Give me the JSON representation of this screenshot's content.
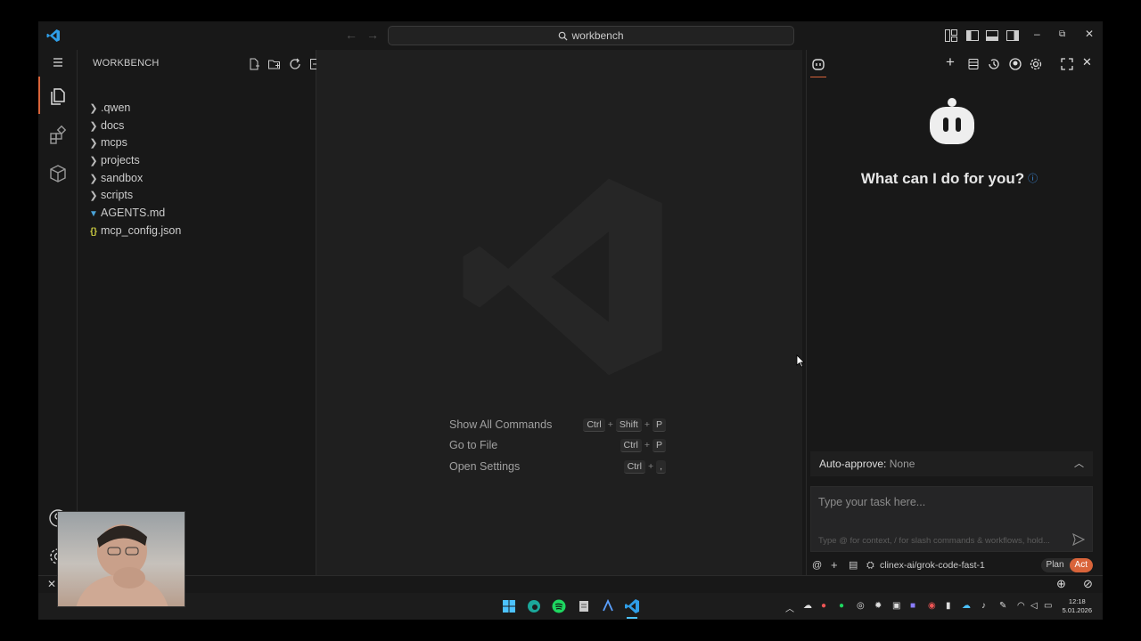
{
  "titlebar": {
    "search_text": "workbench",
    "icons": [
      "vscode-logo",
      "back-arrow",
      "forward-arrow",
      "search-icon",
      "layout-icon",
      "sidebar-left-icon",
      "panel-bottom-icon",
      "sidebar-right-icon",
      "minimize-icon",
      "restore-icon",
      "close-icon"
    ]
  },
  "activitybar": {
    "items": [
      "menu-icon",
      "explorer-icon",
      "extensions-icon",
      "packages-icon",
      "account-icon",
      "settings-icon"
    ]
  },
  "sidebar": {
    "title": "WORKBENCH",
    "tree": [
      {
        "label": ".qwen",
        "kind": "folder"
      },
      {
        "label": "docs",
        "kind": "folder"
      },
      {
        "label": "mcps",
        "kind": "folder"
      },
      {
        "label": "projects",
        "kind": "folder"
      },
      {
        "label": "sandbox",
        "kind": "folder"
      },
      {
        "label": "scripts",
        "kind": "folder"
      },
      {
        "label": "AGENTS.md",
        "kind": "markdown"
      },
      {
        "label": "mcp_config.json",
        "kind": "json"
      }
    ]
  },
  "editor": {
    "shortcuts": [
      {
        "label": "Show All Commands",
        "keys": [
          "Ctrl",
          "Shift",
          "P"
        ]
      },
      {
        "label": "Go to File",
        "keys": [
          "Ctrl",
          "P"
        ]
      },
      {
        "label": "Open Settings",
        "keys": [
          "Ctrl",
          ","
        ]
      }
    ]
  },
  "assistant": {
    "welcome": "What can I do for you?",
    "auto_approve_label": "Auto-approve:",
    "auto_approve_value": "None",
    "task_placeholder": "Type your task here...",
    "task_hint": "Type @ for context, / for slash commands & workflows, hold...",
    "model": "clinex-ai/grok-code-fast-1",
    "mode_plan": "Plan",
    "mode_act": "Act",
    "accent_color": "#d9643a"
  },
  "taskbar": {
    "time": "12:18",
    "date": "5.01.2026"
  }
}
